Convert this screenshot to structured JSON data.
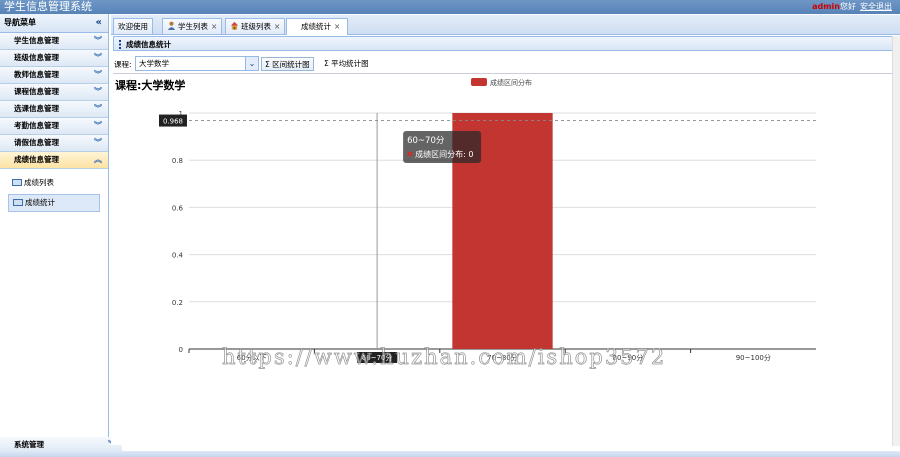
{
  "header": {
    "app_title": "学生信息管理系统",
    "user_name": "admin",
    "greeting": "您好",
    "logout": "安全退出"
  },
  "sidebar": {
    "title": "导航菜单",
    "menus": [
      {
        "label": "学生信息管理"
      },
      {
        "label": "班级信息管理"
      },
      {
        "label": "教师信息管理"
      },
      {
        "label": "课程信息管理"
      },
      {
        "label": "选课信息管理"
      },
      {
        "label": "考勤信息管理"
      },
      {
        "label": "请假信息管理"
      },
      {
        "label": "成绩信息管理"
      }
    ],
    "sub_items": [
      {
        "label": "成绩列表"
      },
      {
        "label": "成绩统计"
      }
    ],
    "system_menu": "系统管理"
  },
  "tabs": [
    {
      "label": "欢迎使用"
    },
    {
      "label": "学生列表"
    },
    {
      "label": "班级列表"
    },
    {
      "label": "成绩统计"
    }
  ],
  "panel": {
    "title": "成绩信息统计"
  },
  "toolbar": {
    "course_label": "课程:",
    "course_value": "大学数学",
    "interval_btn": "区间统计图",
    "avg_btn": "平均统计图"
  },
  "chart_heading": "课程:大学数学",
  "chart_data": {
    "type": "bar",
    "categories": [
      "60分以下",
      "60~70分",
      "70~80分",
      "80~90分",
      "90~100分"
    ],
    "series": [
      {
        "name": "成绩区间分布",
        "values": [
          0,
          0,
          1,
          0,
          0
        ]
      }
    ],
    "ylim": [
      0,
      1
    ],
    "yticks": [
      "0",
      "0.2",
      "0.4",
      "0.6",
      "0.8",
      "1"
    ],
    "pointer_value": "0.968",
    "tooltip": {
      "title": "60~70分",
      "text": "成绩区间分布: 0"
    },
    "axis_pointer_label": "60~70分",
    "bar_color": "#c23531"
  },
  "watermark": "https://www.huzhan.com/ishop3572"
}
